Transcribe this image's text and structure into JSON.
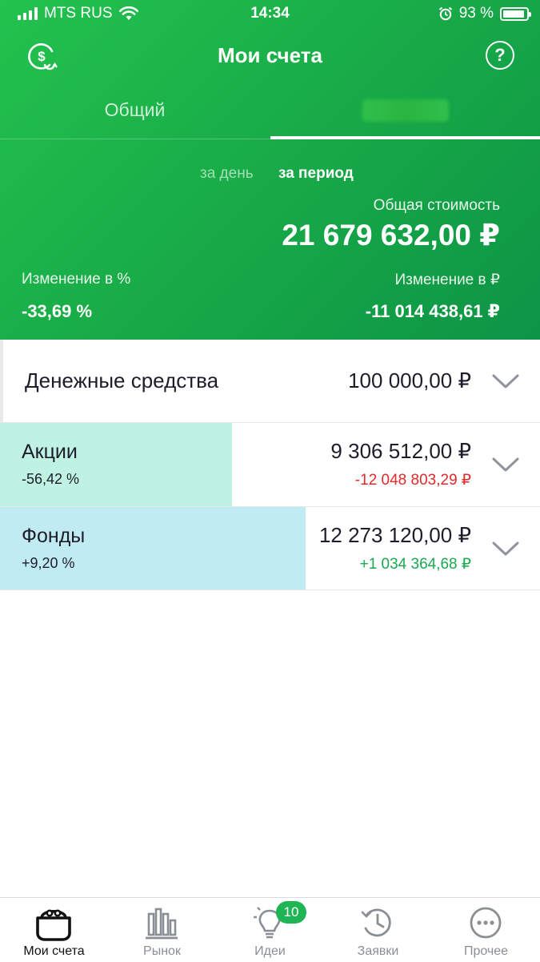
{
  "status_bar": {
    "carrier": "MTS RUS",
    "time": "14:34",
    "battery": "93 %"
  },
  "nav": {
    "title": "Мои счета",
    "help_symbol": "?"
  },
  "tabs": [
    {
      "label": "Общий",
      "active": false
    },
    {
      "label": "",
      "active": true
    }
  ],
  "period": {
    "day": "за день",
    "range": "за период"
  },
  "summary": {
    "total_label": "Общая стоимость",
    "total_value": "21 679 632,00 ₽",
    "change_pct_label": "Изменение в %",
    "change_pct_value": "-33,69 %",
    "change_rub_label": "Изменение в ₽",
    "change_rub_value": "-11 014 438,61 ₽"
  },
  "assets": [
    {
      "name": "Денежные средства",
      "amount": "100 000,00 ₽"
    },
    {
      "name": "Акции",
      "pct": "-56,42 %",
      "amount": "9 306 512,00 ₽",
      "change": "-12 048 803,29 ₽",
      "bar_fraction": 0.43
    },
    {
      "name": "Фонды",
      "pct": "+9,20 %",
      "amount": "12 273 120,00 ₽",
      "change": "+1 034 364,68 ₽",
      "bar_fraction": 0.566
    }
  ],
  "tabbar": [
    {
      "label": "Мои счета",
      "icon": "wallet-icon",
      "active": true
    },
    {
      "label": "Рынок",
      "icon": "bar-chart-icon",
      "active": false
    },
    {
      "label": "Идеи",
      "icon": "lightbulb-icon",
      "active": false,
      "badge": "10"
    },
    {
      "label": "Заявки",
      "icon": "history-clock-icon",
      "active": false
    },
    {
      "label": "Прочее",
      "icon": "more-dots-icon",
      "active": false
    }
  ],
  "colors": {
    "header_green": "#17a847",
    "negative": "#e22a2a",
    "positive": "#19a94f",
    "stocks_bar": "#bff2e3",
    "funds_bar": "#c1ebf2"
  }
}
